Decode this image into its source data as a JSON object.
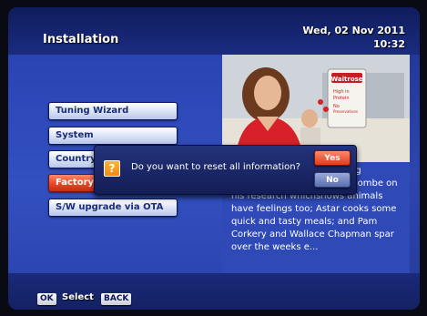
{
  "header": {
    "title": "Installation",
    "date": "Wed, 02 Nov 2011",
    "time": "10:32"
  },
  "menu": {
    "items": [
      {
        "label": "Tuning Wizard"
      },
      {
        "label": "System"
      },
      {
        "label": "Country"
      },
      {
        "label": "Factory"
      },
      {
        "label": "S/W upgrade via OTA"
      }
    ],
    "active_index": 3
  },
  "preview": {
    "sign_text": "Waitrose",
    "sign_lines": [
      "High in",
      "Protein",
      "No",
      "Preservatives"
    ]
  },
  "info": {
    "heading_fragment": "ng",
    "text": "American vet Jonathon Balcombe on his research whichshows animals have feelings too; Astar cooks some quick and tasty meals; and Pam Corkery and Wallace Chapman spar over the weeks e..."
  },
  "dialog": {
    "message": "Do you want to reset all information?",
    "yes_label": "Yes",
    "no_label": "No",
    "icon": "question-icon"
  },
  "footer": {
    "ok_key": "OK",
    "ok_label": "Select",
    "back_key": "BACK"
  },
  "colors": {
    "accent_red": "#e23a1c",
    "panel_blue": "#2d46ae",
    "header_dark": "#0f1c5c"
  }
}
